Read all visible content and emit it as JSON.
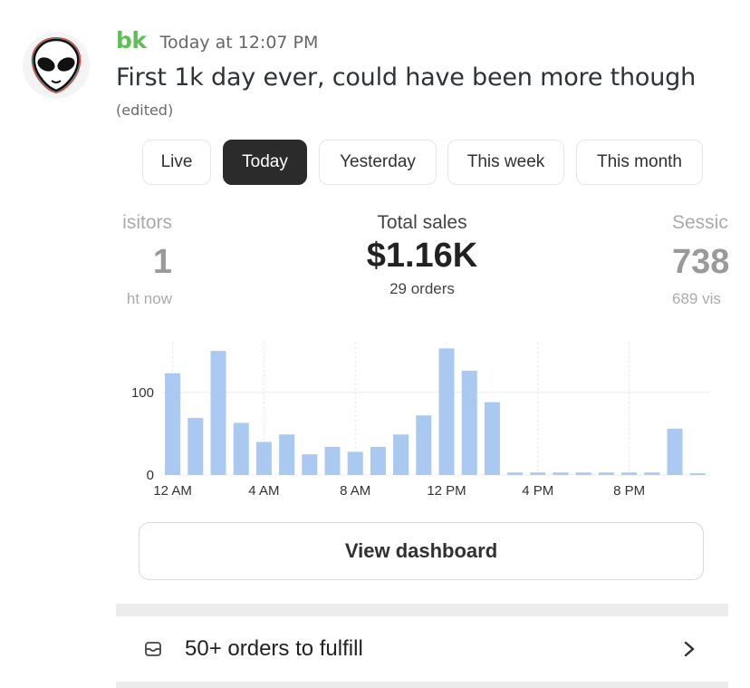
{
  "message": {
    "author": "bk",
    "timestamp": "Today at 12:07 PM",
    "text": "First 1k day ever, could have been more though",
    "edited": "(edited)",
    "author_color": "#5fbf57"
  },
  "tabs": [
    {
      "label": "Live",
      "active": false
    },
    {
      "label": "Today",
      "active": true
    },
    {
      "label": "Yesterday",
      "active": false
    },
    {
      "label": "This week",
      "active": false
    },
    {
      "label": "This month",
      "active": false
    }
  ],
  "metrics": {
    "left": {
      "label": "isitors",
      "value": "1",
      "sub": "ht now"
    },
    "center": {
      "label": "Total sales",
      "value": "$1.16K",
      "sub": "29 orders"
    },
    "right": {
      "label": "Sessic",
      "value": "738",
      "sub": "689 vis"
    }
  },
  "chart_data": {
    "type": "bar",
    "bar_color": "#a9c9f1",
    "ylim": [
      0,
      160
    ],
    "y_ticks": [
      {
        "value": 0,
        "label": "0"
      },
      {
        "value": 100,
        "label": "100"
      }
    ],
    "x_ticks": [
      {
        "index": 0,
        "label": "12 AM"
      },
      {
        "index": 4,
        "label": "4 AM"
      },
      {
        "index": 8,
        "label": "8 AM"
      },
      {
        "index": 12,
        "label": "12 PM"
      },
      {
        "index": 16,
        "label": "4 PM"
      },
      {
        "index": 20,
        "label": "8 PM"
      }
    ],
    "values": [
      123,
      69,
      150,
      63,
      40,
      49,
      25,
      34,
      28,
      34,
      49,
      72,
      153,
      126,
      88,
      3,
      3,
      3,
      3,
      3,
      3,
      3,
      56,
      2
    ]
  },
  "dashboard_button": {
    "label": "View dashboard"
  },
  "fulfill": {
    "text": "50+ orders to fulfill",
    "icon": "tray-icon"
  }
}
